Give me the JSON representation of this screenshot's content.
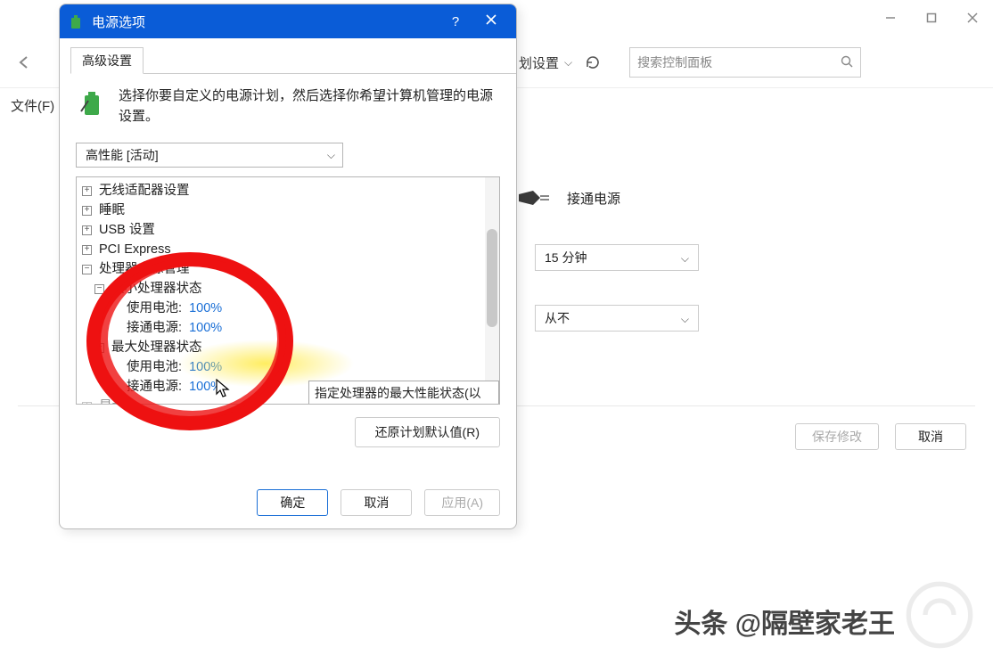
{
  "parent": {
    "file_menu": "文件(F)",
    "breadcrumb_tail": "划设置",
    "search_placeholder": "搜索控制面板",
    "plug_label": "接通电源",
    "combo1": "15 分钟",
    "combo2": "从不",
    "save_btn": "保存修改",
    "cancel_btn": "取消"
  },
  "watermark": {
    "prefix": "头条",
    "at": "@",
    "author": "隔壁家老王"
  },
  "dialog": {
    "title": "电源选项",
    "tab": "高级设置",
    "description": "选择你要自定义的电源计划，然后选择你希望计算机管理的电源设置。",
    "plan": "高性能 [活动]",
    "tree": {
      "wireless": "无线适配器设置",
      "sleep": "睡眠",
      "usb": "USB 设置",
      "pci": "PCI Express",
      "cpu": "处理器电源管理",
      "min_state": "最小处理器状态",
      "max_state": "最大处理器状态",
      "on_battery": "使用电池:",
      "plugged_in": "接通电源:",
      "val_min_batt": "100%",
      "val_min_plug": "100%",
      "val_max_batt": "100%",
      "val_max_plug": "100%",
      "display": "显示"
    },
    "tooltip": "指定处理器的最大性能状态(以百分比)。",
    "restore_btn": "还原计划默认值(R)",
    "ok_btn": "确定",
    "cancel_btn": "取消",
    "apply_btn": "应用(A)"
  }
}
